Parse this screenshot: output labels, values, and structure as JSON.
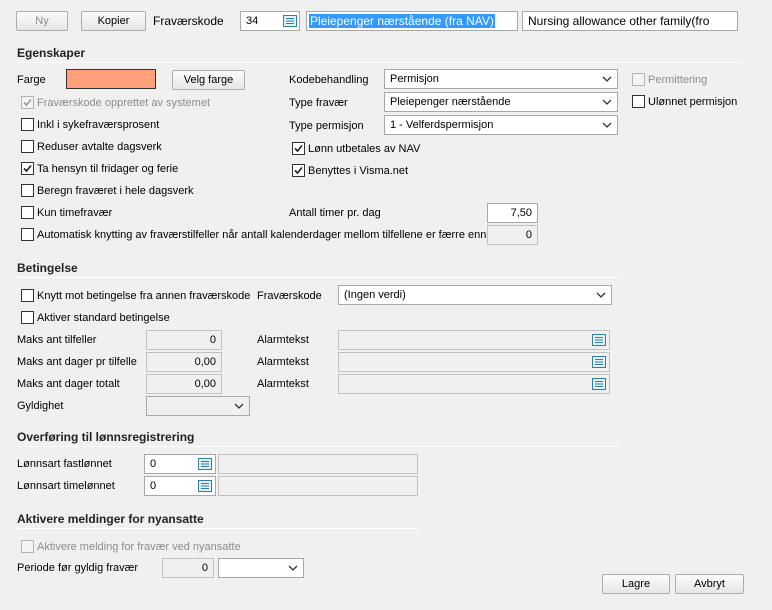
{
  "header": {
    "ny_label": "Ny",
    "kopier_label": "Kopier",
    "fravaerskode_label": "Fraværskode",
    "code_value": "34",
    "name_value": "Pleiepenger nærstående (fra NAV)",
    "name_en_value": "Nursing allowance other family(fro"
  },
  "egenskaper": {
    "title": "Egenskaper",
    "farge_label": "Farge",
    "farge_color": "#ffa07a",
    "velg_farge_label": "Velg farge",
    "checkboxes": [
      {
        "label": "Fraværskode opprettet av systemet",
        "checked": true,
        "disabled": true
      },
      {
        "label": "Inkl i sykefraværsprosent",
        "checked": false,
        "disabled": false
      },
      {
        "label": "Reduser avtalte dagsverk",
        "checked": false,
        "disabled": false
      },
      {
        "label": "Ta hensyn til fridager og ferie",
        "checked": true,
        "disabled": false
      },
      {
        "label": "Beregn fraværet i hele dagsverk",
        "checked": false,
        "disabled": false
      },
      {
        "label": "Kun timefravær",
        "checked": false,
        "disabled": false
      },
      {
        "label": "Automatisk knytting av fraværstilfeller når antall kalenderdager mellom tilfellene er færre enn",
        "checked": false,
        "disabled": false
      }
    ],
    "kodebehandling_label": "Kodebehandling",
    "kodebehandling_value": "Permisjon",
    "type_fravaer_label": "Type fravær",
    "type_fravaer_value": "Pleiepenger nærstående",
    "type_permisjon_label": "Type permisjon",
    "type_permisjon_value": "1 - Velferdspermisjon",
    "lonn_nav_label": "Lønn utbetales av NAV",
    "lonn_nav_checked": true,
    "visma_label": "Benyttes i Visma.net",
    "visma_checked": true,
    "permittering_label": "Permittering",
    "permittering_checked": false,
    "ulonnet_label": "Ulønnet permisjon",
    "ulonnet_checked": false,
    "antall_timer_label": "Antall timer pr. dag",
    "antall_timer_value": "7,50",
    "kalenderdager_value": "0"
  },
  "betingelse": {
    "title": "Betingelse",
    "knytt_label": "Knytt mot betingelse fra annen fraværskode",
    "knytt_checked": false,
    "fravaerskode_label": "Fraværskode",
    "fravaerskode_value": "(Ingen verdi)",
    "aktiver_label": "Aktiver standard betingelse",
    "aktiver_checked": false,
    "rows": [
      {
        "label": "Maks ant tilfeller",
        "value": "0",
        "alarm_label": "Alarmtekst",
        "alarm_value": ""
      },
      {
        "label": "Maks ant dager pr tilfelle",
        "value": "0,00",
        "alarm_label": "Alarmtekst",
        "alarm_value": ""
      },
      {
        "label": "Maks ant dager totalt",
        "value": "0,00",
        "alarm_label": "Alarmtekst",
        "alarm_value": ""
      }
    ],
    "gyldighet_label": "Gyldighet",
    "gyldighet_value": ""
  },
  "overforing": {
    "title": "Overføring til lønnsregistrering",
    "fast_label": "Lønnsart fastlønnet",
    "fast_value": "0",
    "fast_desc": "",
    "time_label": "Lønnsart timelønnet",
    "time_value": "0",
    "time_desc": ""
  },
  "aktivere": {
    "title": "Aktivere meldinger for nyansatte",
    "melding_label": "Aktivere melding for fravær ved nyansatte",
    "melding_checked": false,
    "periode_label": "Periode før gyldig fravær",
    "periode_value": "0",
    "periode_unit": ""
  },
  "footer": {
    "lagre_label": "Lagre",
    "avbryt_label": "Avbryt"
  },
  "icons": {
    "list": "list-icon",
    "chevron": "chevron-down-icon",
    "check": "check-icon"
  }
}
